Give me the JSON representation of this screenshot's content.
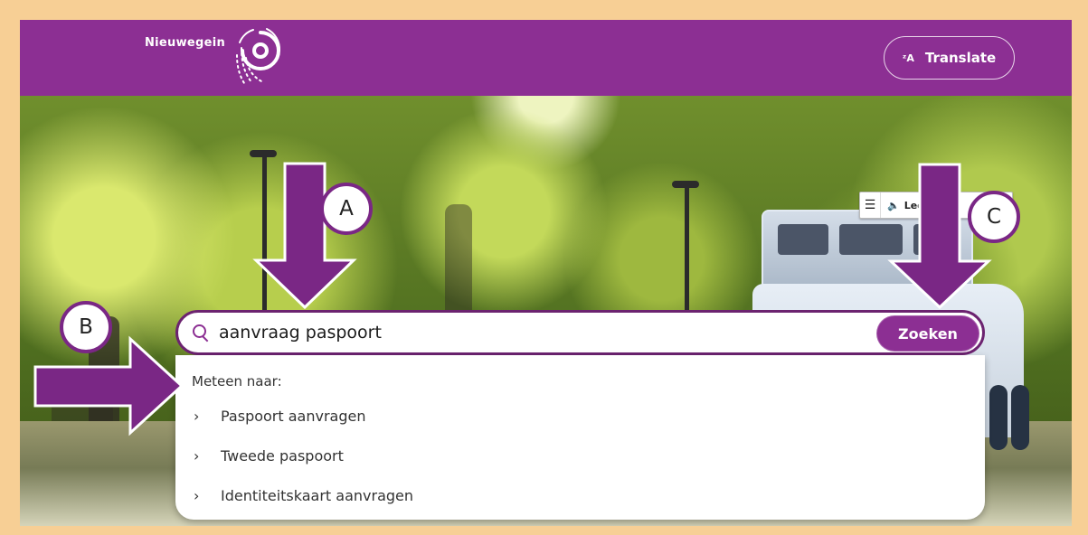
{
  "header": {
    "brand": "Nieuwegein",
    "translate_icon": "translate-icon",
    "translate_label": "Translate",
    "accent": "#8c2f93"
  },
  "readspeaker": {
    "menu_icon": "menu-icon",
    "speaker_icon": "speaker-icon",
    "label": "Lees voor",
    "play_icon": "play-icon"
  },
  "search": {
    "icon": "search-icon",
    "value": "aanvraag paspoort",
    "button_label": "Zoeken",
    "dropdown_title": "Meteen naar:",
    "suggestions": [
      {
        "label": "Paspoort aanvragen",
        "icon": "chevron-right-icon"
      },
      {
        "label": "Tweede paspoort",
        "icon": "chevron-right-icon"
      },
      {
        "label": "Identiteitskaart aanvragen",
        "icon": "chevron-right-icon"
      }
    ]
  },
  "annotations": {
    "a": "A",
    "b": "B",
    "c": "C",
    "color": "#7a2785"
  }
}
